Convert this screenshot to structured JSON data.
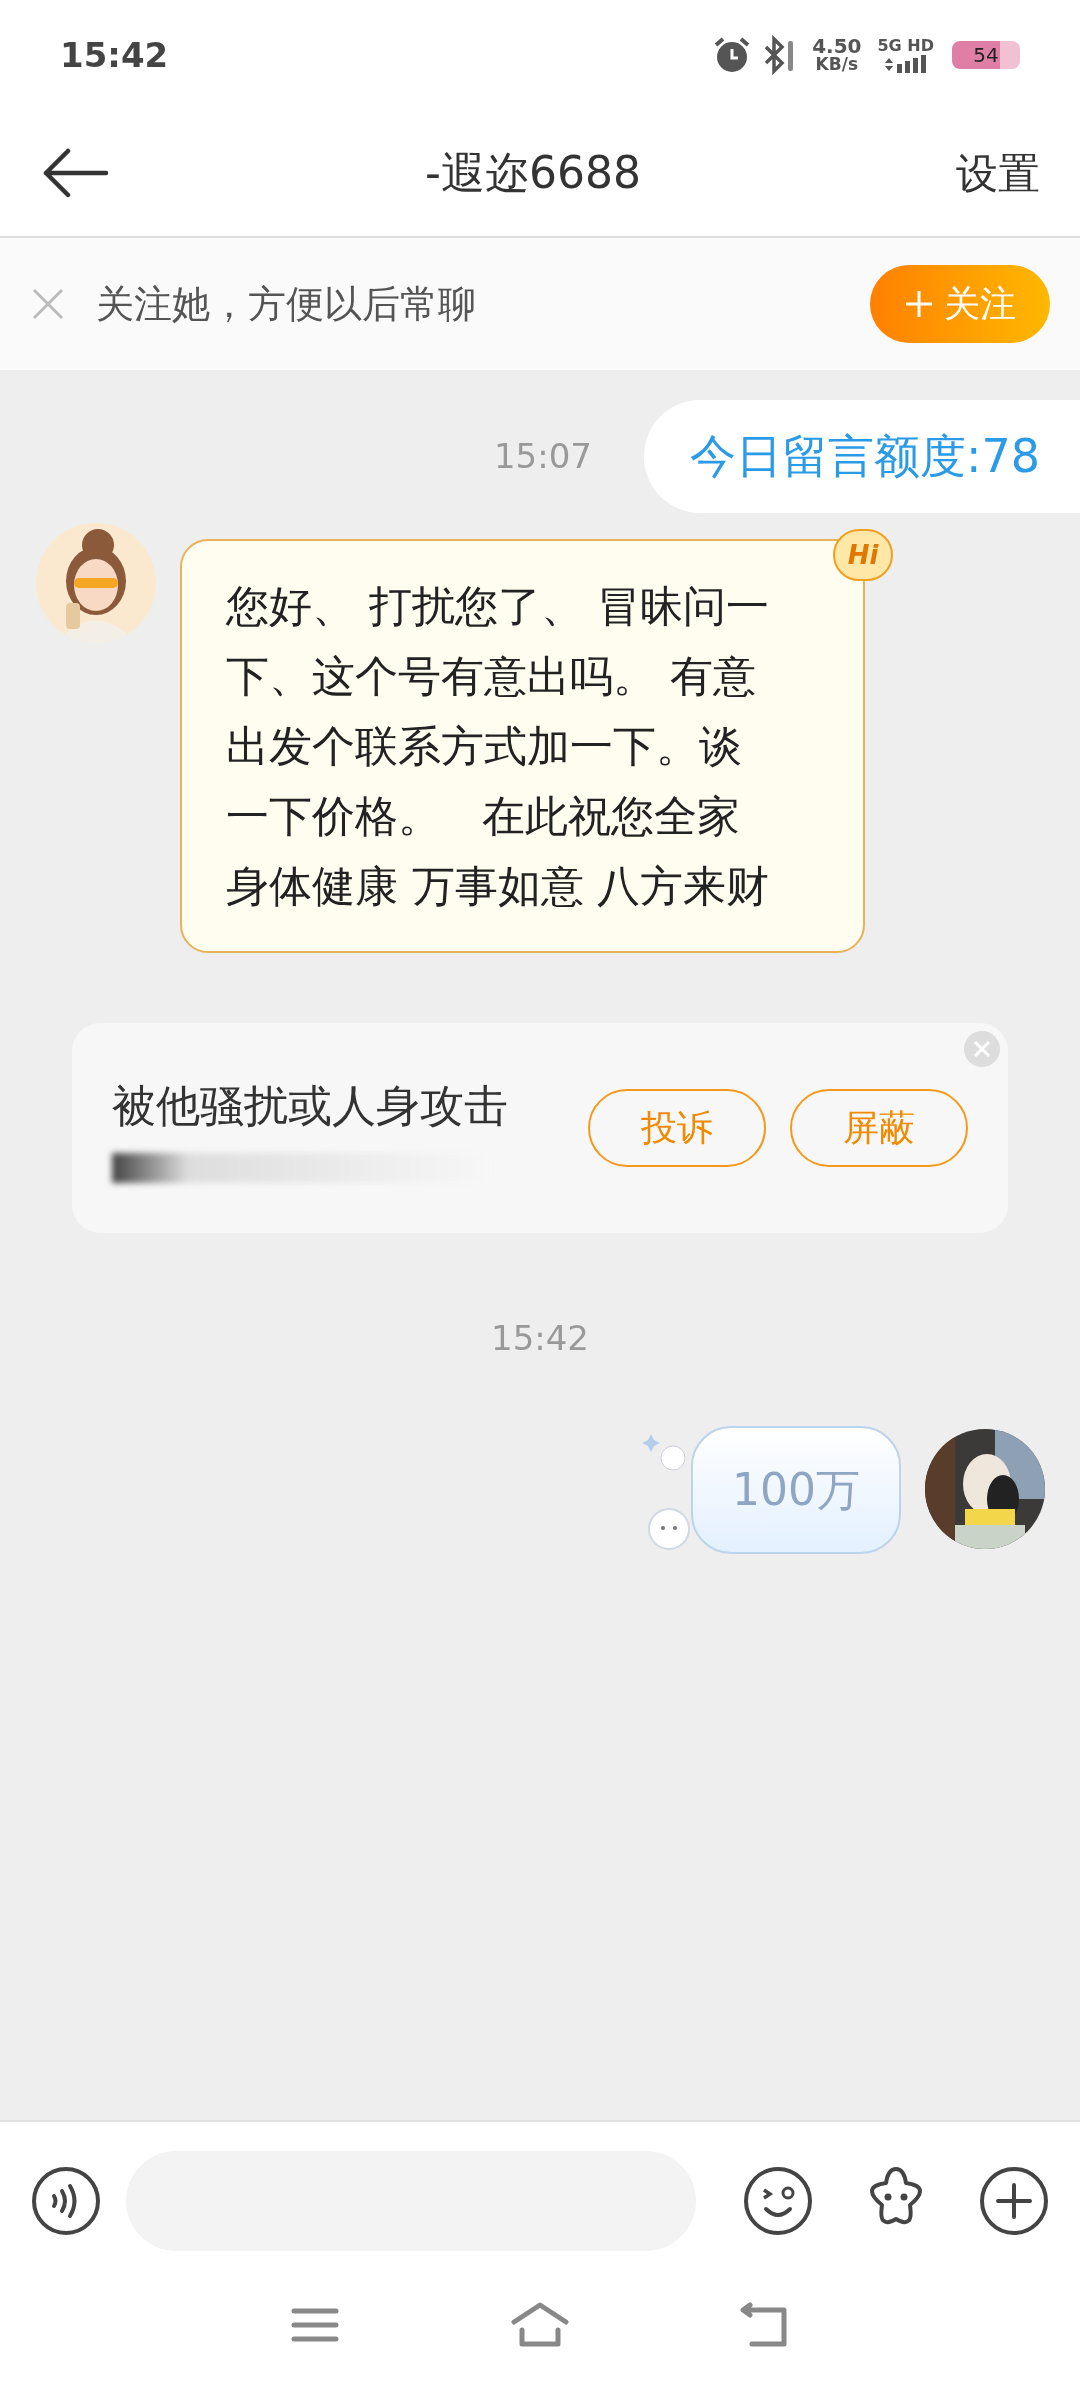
{
  "status_bar": {
    "time": "15:42",
    "speed_value": "4.50",
    "speed_unit": "KB/s",
    "network": "5G HD",
    "battery": "54"
  },
  "header": {
    "title": "-遐迩6688",
    "settings": "设置"
  },
  "follow_banner": {
    "text": "关注她，方便以后常聊",
    "button": "关注"
  },
  "messages": [
    {
      "kind": "time",
      "text": "15:07"
    },
    {
      "kind": "quota",
      "text": "今日留言额度:78"
    },
    {
      "kind": "incoming",
      "lines": [
        "您好、 打扰您了、 冒昧问一",
        "下、这个号有意出吗。 有意",
        "出发个联系方式加一下。谈",
        "一下价格。   在此祝您全家",
        "身体健康 万事如意 八方来财"
      ],
      "hi_badge": "Hi"
    },
    {
      "kind": "report",
      "text": "被他骚扰或人身攻击",
      "buttons": [
        "投诉",
        "屏蔽"
      ]
    },
    {
      "kind": "time",
      "text": "15:42"
    },
    {
      "kind": "sticker",
      "text": "100万"
    }
  ]
}
